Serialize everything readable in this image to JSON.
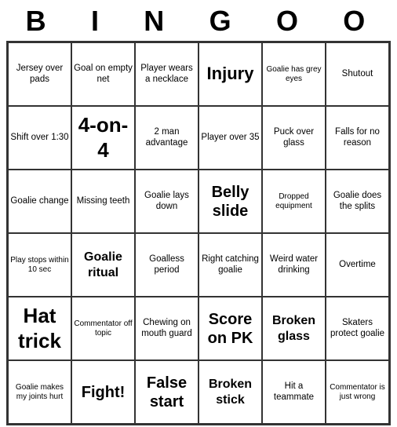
{
  "title": {
    "letters": [
      "B",
      "I",
      "N",
      "G",
      "O",
      "O"
    ]
  },
  "cells": [
    {
      "text": "Jersey over pads",
      "size": "normal"
    },
    {
      "text": "Goal on empty net",
      "size": "normal"
    },
    {
      "text": "Player wears a necklace",
      "size": "normal"
    },
    {
      "text": "Injury",
      "size": "large"
    },
    {
      "text": "Goalie has grey eyes",
      "size": "small"
    },
    {
      "text": "Shutout",
      "size": "normal"
    },
    {
      "text": "Shift over 1:30",
      "size": "normal"
    },
    {
      "text": "4-on-4",
      "size": "xlarge"
    },
    {
      "text": "2 man advantage",
      "size": "normal"
    },
    {
      "text": "Player over 35",
      "size": "normal"
    },
    {
      "text": "Puck over glass",
      "size": "normal"
    },
    {
      "text": "Falls for no reason",
      "size": "normal"
    },
    {
      "text": "Goalie change",
      "size": "normal"
    },
    {
      "text": "Missing teeth",
      "size": "normal"
    },
    {
      "text": "Goalie lays down",
      "size": "normal"
    },
    {
      "text": "Belly slide",
      "size": "big"
    },
    {
      "text": "Dropped equipment",
      "size": "small"
    },
    {
      "text": "Goalie does the splits",
      "size": "normal"
    },
    {
      "text": "Play stops within 10 sec",
      "size": "small"
    },
    {
      "text": "Goalie ritual",
      "size": "medium"
    },
    {
      "text": "Goalless period",
      "size": "normal"
    },
    {
      "text": "Right catching goalie",
      "size": "normal"
    },
    {
      "text": "Weird water drinking",
      "size": "normal"
    },
    {
      "text": "Overtime",
      "size": "normal"
    },
    {
      "text": "Hat trick",
      "size": "xlarge"
    },
    {
      "text": "Commentator off topic",
      "size": "small"
    },
    {
      "text": "Chewing on mouth guard",
      "size": "normal"
    },
    {
      "text": "Score on PK",
      "size": "big"
    },
    {
      "text": "Broken glass",
      "size": "medium"
    },
    {
      "text": "Skaters protect goalie",
      "size": "normal"
    },
    {
      "text": "Goalie makes my joints hurt",
      "size": "small"
    },
    {
      "text": "Fight!",
      "size": "big"
    },
    {
      "text": "False start",
      "size": "big"
    },
    {
      "text": "Broken stick",
      "size": "medium"
    },
    {
      "text": "Hit a teammate",
      "size": "normal"
    },
    {
      "text": "Commentator is just wrong",
      "size": "small"
    }
  ]
}
